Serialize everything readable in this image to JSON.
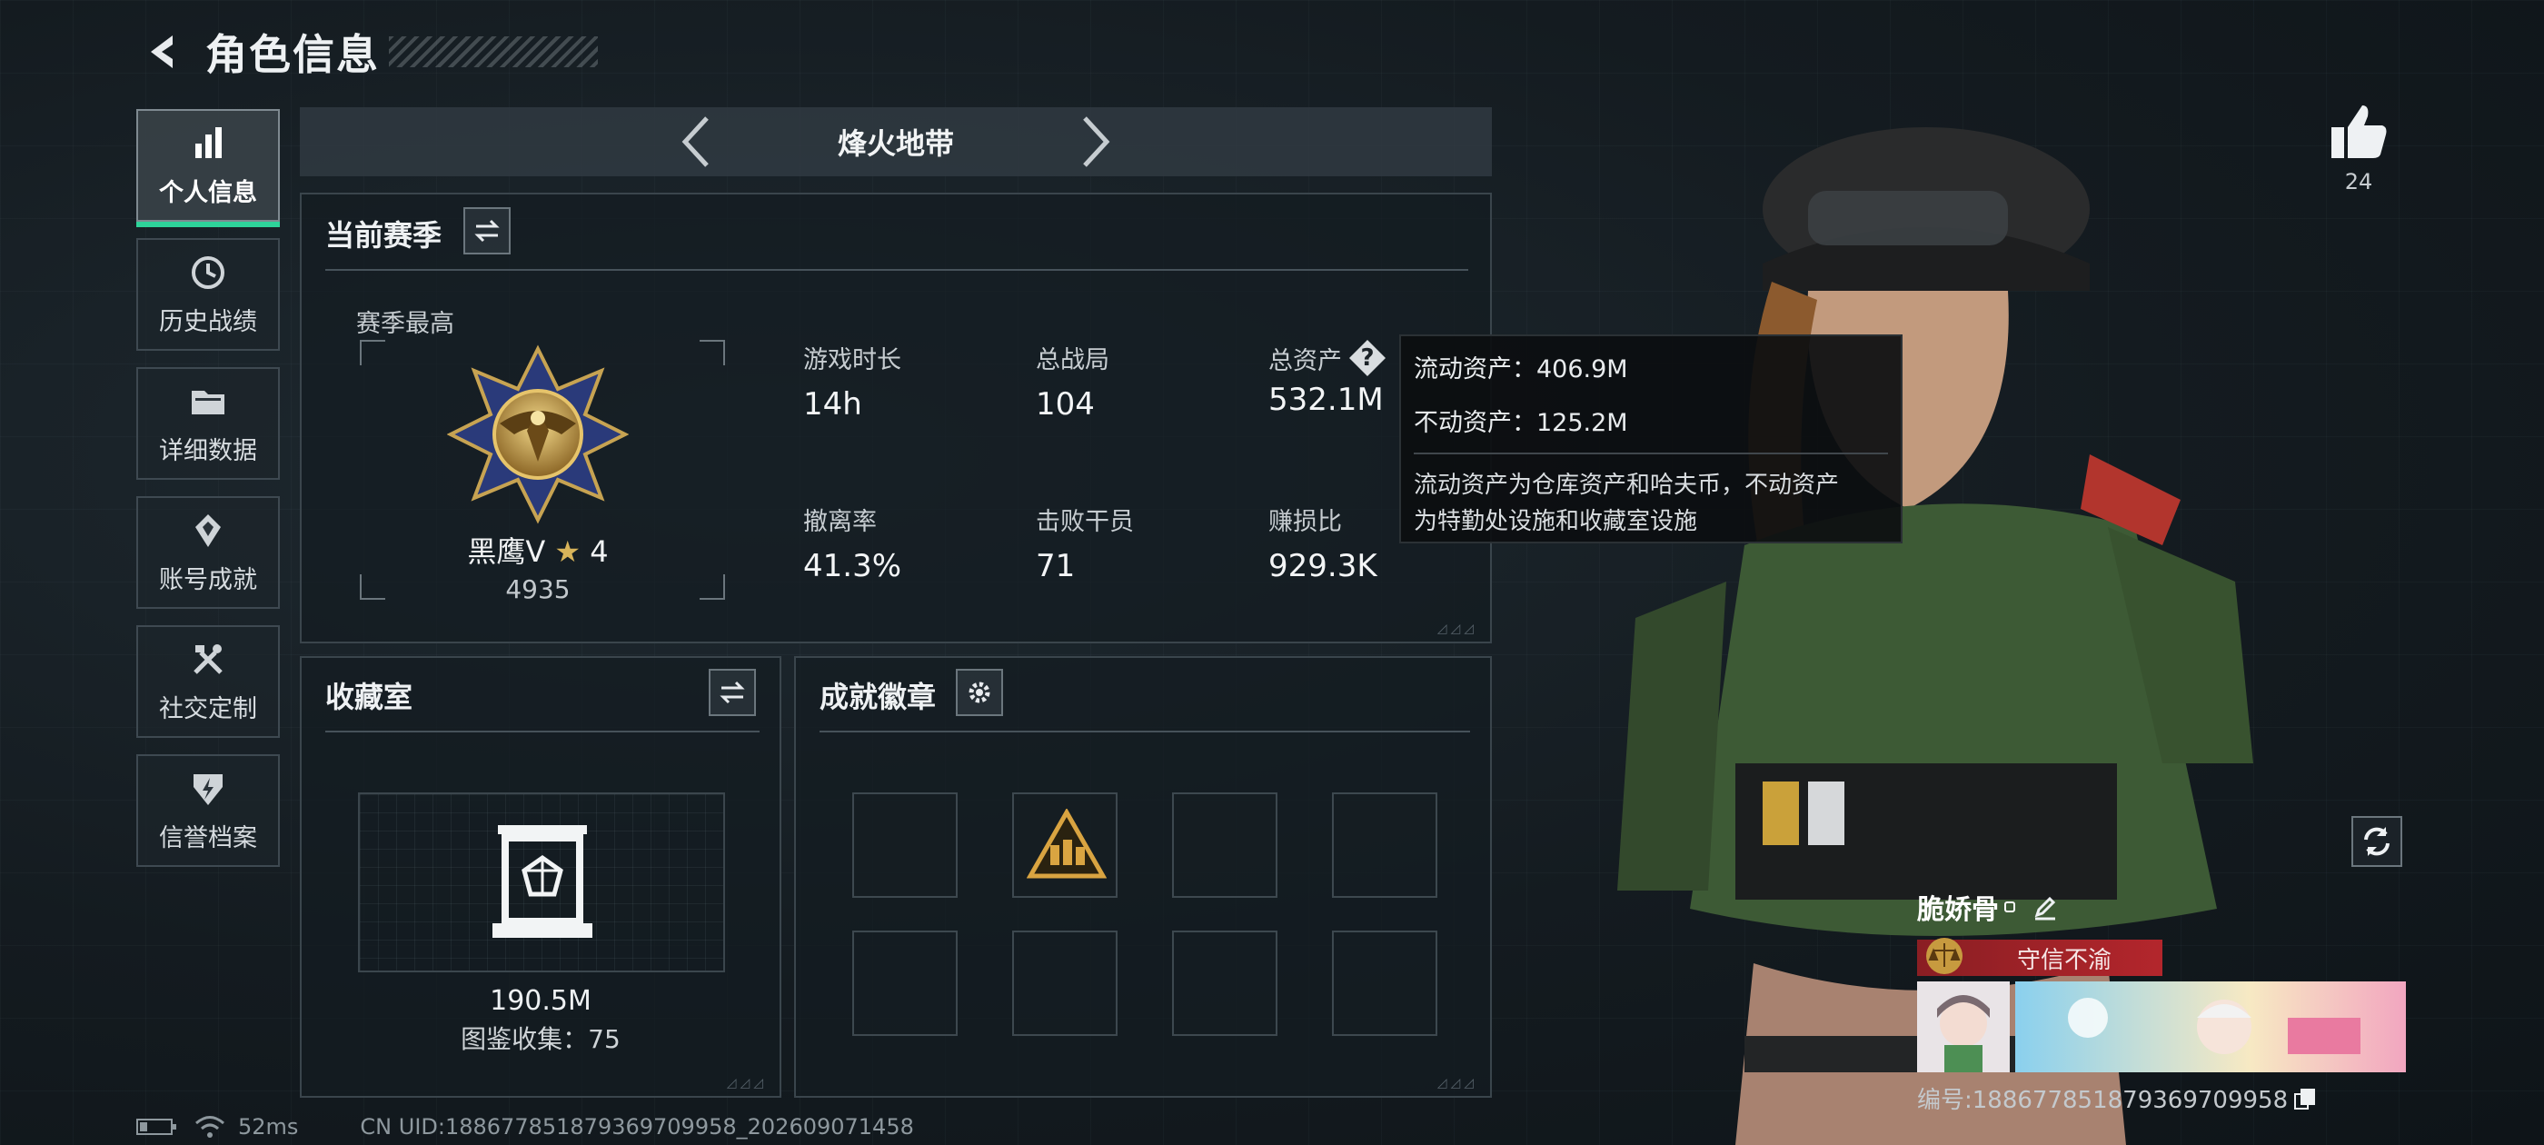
{
  "header": {
    "title": "角色信息"
  },
  "sidebar": {
    "items": [
      {
        "label": "个人信息",
        "icon": "bar-chart-icon",
        "active": true
      },
      {
        "label": "历史战绩",
        "icon": "history-icon"
      },
      {
        "label": "详细数据",
        "icon": "folder-icon"
      },
      {
        "label": "账号成就",
        "icon": "achievement-icon"
      },
      {
        "label": "社交定制",
        "icon": "tools-icon"
      },
      {
        "label": "信誉档案",
        "icon": "shield-lightning-icon"
      }
    ]
  },
  "mode_selector": {
    "name": "烽火地带"
  },
  "season": {
    "title": "当前赛季",
    "best_label": "赛季最高",
    "rank_name": "黑鹰Ⅴ",
    "rank_stars": "4",
    "rank_score": "4935",
    "stats": [
      {
        "label": "游戏时长",
        "value": "14h"
      },
      {
        "label": "总战局",
        "value": "104"
      },
      {
        "label": "总资产",
        "value": "532.1M"
      },
      {
        "label": "撤离率",
        "value": "41.3%"
      },
      {
        "label": "击败干员",
        "value": "71"
      },
      {
        "label": "赚损比",
        "value": "929.3K"
      }
    ]
  },
  "tooltip": {
    "liquid": "流动资产：406.9M",
    "fixed": "不动资产：125.2M",
    "description_1": "流动资产为仓库资产和哈夫币，不动资产",
    "description_2": "为特勤处设施和收藏室设施"
  },
  "collection": {
    "title": "收藏室",
    "value": "190.5M",
    "count": "图鉴收集：75"
  },
  "badges": {
    "title": "成就徽章"
  },
  "player": {
    "likes": "24",
    "name": "脆娇骨",
    "title": "守信不渝",
    "id": "编号:18867785187936970995​8"
  },
  "status": {
    "ping": "52ms",
    "uid": "CN UID:18867785187936970995​8_202609071458"
  },
  "colors": {
    "accent_green": "#2ed39a",
    "title_red": "#b3262c"
  }
}
